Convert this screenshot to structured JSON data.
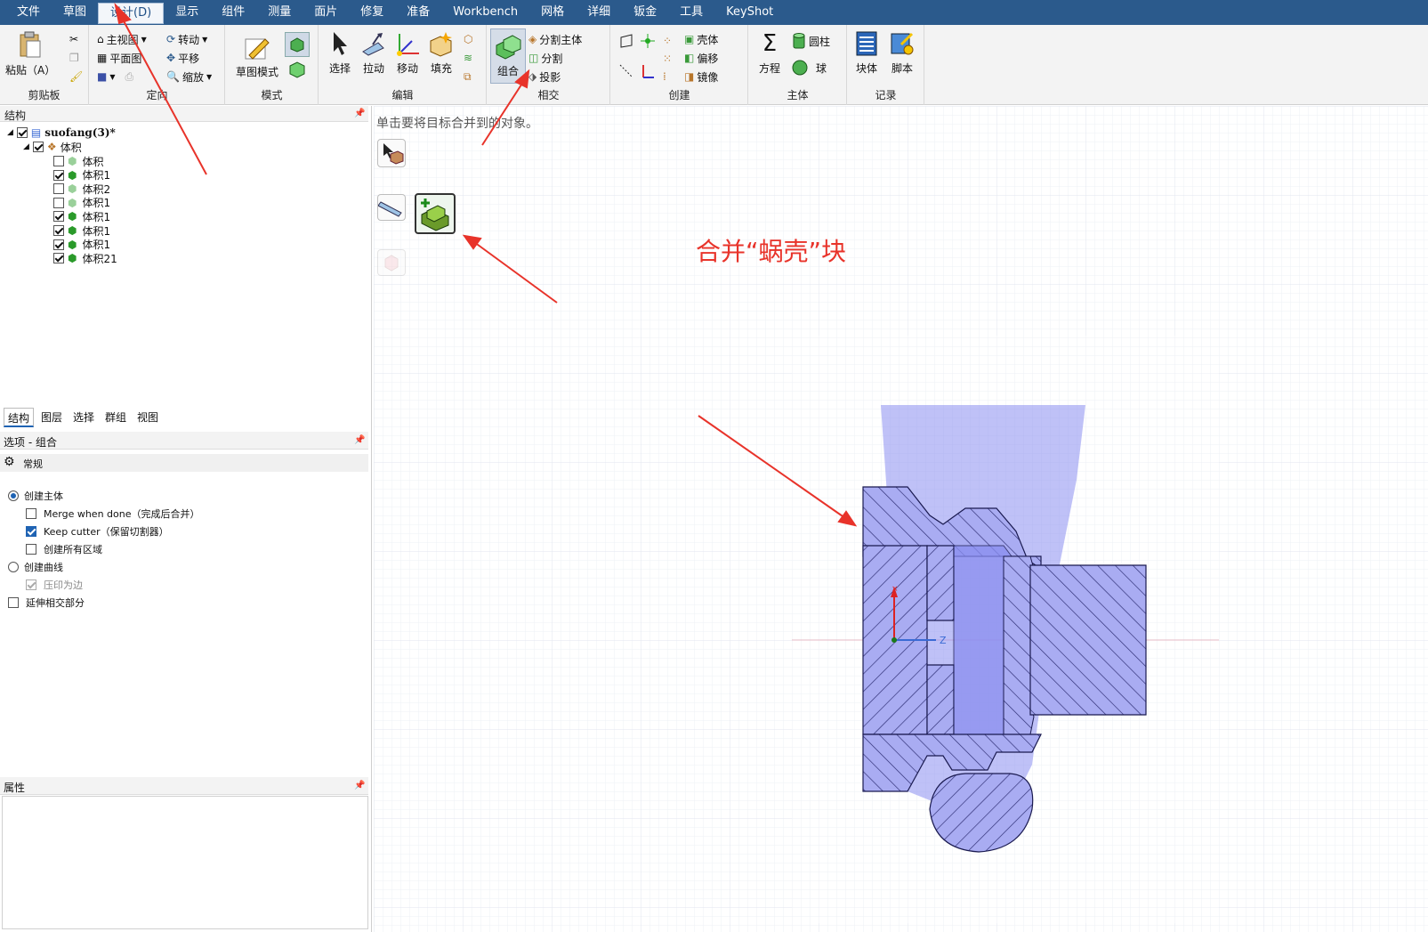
{
  "menubar": {
    "items": [
      "文件",
      "草图",
      "设计(D)",
      "显示",
      "组件",
      "测量",
      "面片",
      "修复",
      "准备",
      "Workbench",
      "网格",
      "详细",
      "钣金",
      "工具",
      "KeyShot"
    ],
    "active_index": 2
  },
  "ribbon": {
    "clipboard": {
      "paste": "粘贴（A）",
      "label": "剪贴板"
    },
    "orient": {
      "home_view": "主视图",
      "plan_view": "平面图",
      "rotate": "转动",
      "pan": "平移",
      "zoom": "缩放",
      "label": "定向"
    },
    "mode": {
      "sketch_mode": "草图模式",
      "label": "模式"
    },
    "edit": {
      "select": "选择",
      "pull": "拉动",
      "move": "移动",
      "fill": "填充",
      "label": "编辑"
    },
    "intersect": {
      "combine": "组合",
      "split_body": "分割主体",
      "split": "分割",
      "project": "投影",
      "label": "相交"
    },
    "create": {
      "shell": "壳体",
      "offset": "偏移",
      "mirror": "镜像",
      "label": "创建"
    },
    "body": {
      "equation": "方程",
      "cylinder": "圆柱",
      "sphere": "球",
      "label": "主体"
    },
    "record": {
      "block": "块体",
      "script": "脚本",
      "label": "记录"
    }
  },
  "structure": {
    "title": "结构",
    "root": "suofang(3)*",
    "group": "体积",
    "items": [
      {
        "label": "体积",
        "checked": false
      },
      {
        "label": "体积1",
        "checked": true
      },
      {
        "label": "体积2",
        "checked": false
      },
      {
        "label": "体积1",
        "checked": false
      },
      {
        "label": "体积1",
        "checked": true
      },
      {
        "label": "体积1",
        "checked": true
      },
      {
        "label": "体积1",
        "checked": true
      },
      {
        "label": "体积21",
        "checked": true
      }
    ]
  },
  "tabs": [
    "结构",
    "图层",
    "选择",
    "群组",
    "视图"
  ],
  "options": {
    "title": "选项 - 组合",
    "section": "常规",
    "create_body": "创建主体",
    "merge_when_done": "Merge when done（完成后合并）",
    "keep_cutter": "Keep cutter（保留切割器）",
    "create_all_regions": "创建所有区域",
    "create_curves": "创建曲线",
    "imprint_edges": "压印为边",
    "extend_intersect": "延伸相交部分"
  },
  "properties": {
    "title": "属性"
  },
  "viewport": {
    "hint": "单击要将目标合并到的对象。",
    "annotation": "合并“蜗壳”块",
    "axis_z": "Z",
    "annotation_color": "#e8332a",
    "body_color": "#8a8ef0"
  },
  "colors": {
    "menubar": "#2b5a8c",
    "arrow": "#e8332a"
  }
}
